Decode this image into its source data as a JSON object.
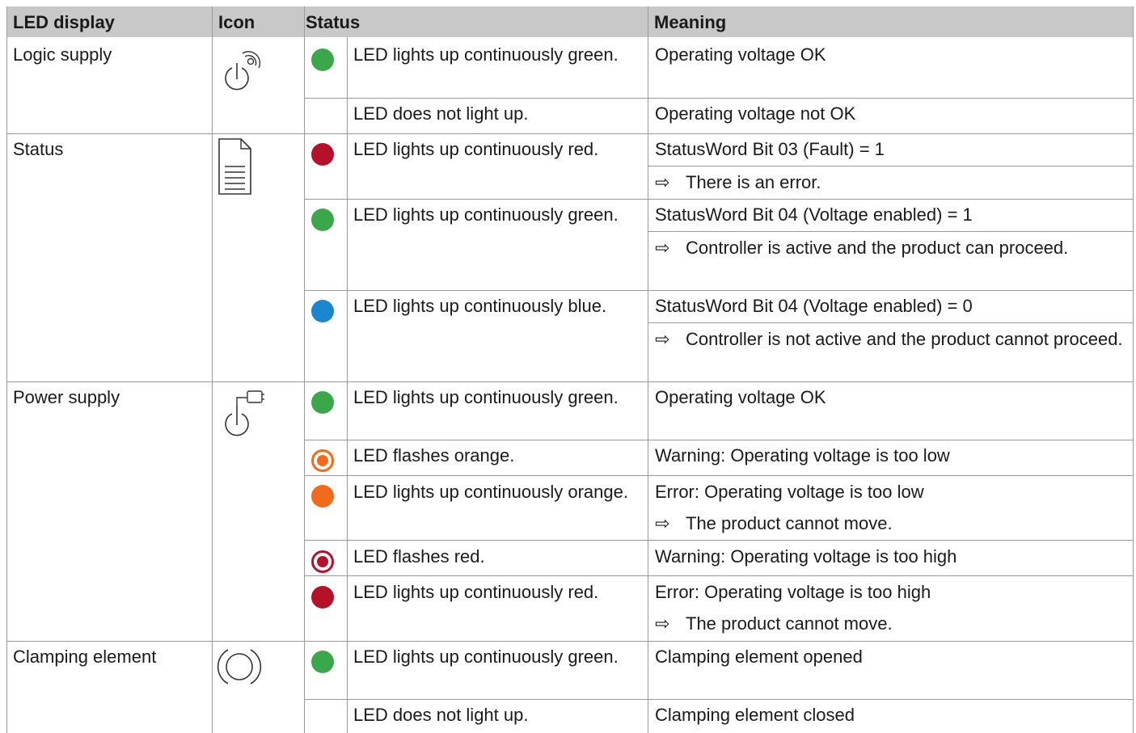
{
  "columns": [
    "LED display",
    "Icon",
    "Status",
    "Meaning"
  ],
  "colors": {
    "green": "#3aa84a",
    "red": "#b5122a",
    "blue": "#1a86d0",
    "orange": "#f26a1b",
    "header_bg": "#c8c8c8",
    "rule": "#9a9a9a"
  },
  "arrow_glyph": "⇨",
  "rows": [
    {
      "display": "Logic supply",
      "icon": "logic-supply-icon",
      "statuses": [
        {
          "led": "green",
          "text": "LED lights up continuously green.",
          "meanings": [
            "Operating voltage OK"
          ]
        },
        {
          "led": "none",
          "text": "LED does not light up.",
          "meanings": [
            "Operating voltage not OK"
          ]
        }
      ]
    },
    {
      "display": "Status",
      "icon": "document-icon",
      "statuses": [
        {
          "led": "red",
          "text": "LED lights up continuously red.",
          "meanings": [
            "StatusWord Bit 03 (Fault) = 1",
            "There is an error."
          ]
        },
        {
          "led": "green",
          "text": "LED lights up continuously green.",
          "meanings": [
            "StatusWord Bit 04 (Voltage enabled) = 1",
            "Controller is active and the product can proceed."
          ]
        },
        {
          "led": "blue",
          "text": "LED lights up continuously blue.",
          "meanings": [
            "StatusWord Bit 04 (Voltage enabled) = 0",
            "Controller is not active and the product cannot proceed."
          ]
        }
      ]
    },
    {
      "display": "Power supply",
      "icon": "power-supply-icon",
      "statuses": [
        {
          "led": "green",
          "text": "LED lights up continuously green.",
          "meanings": [
            "Operating voltage OK"
          ]
        },
        {
          "led": "orange-flash",
          "text": "LED flashes orange.",
          "meanings": [
            "Warning: Operating voltage is too low"
          ]
        },
        {
          "led": "orange",
          "text": "LED lights up continuously orange.",
          "meanings": [
            "Error: Operating voltage is too low",
            "The product cannot move."
          ]
        },
        {
          "led": "red-flash",
          "text": "LED flashes red.",
          "meanings": [
            "Warning: Operating voltage is too high"
          ]
        },
        {
          "led": "red",
          "text": "LED lights up continuously red.",
          "meanings": [
            "Error: Operating voltage is too high",
            "The product cannot move."
          ]
        }
      ]
    },
    {
      "display": "Clamping element",
      "icon": "clamping-element-icon",
      "statuses": [
        {
          "led": "green",
          "text": "LED lights up continuously green.",
          "meanings": [
            "Clamping element opened"
          ]
        },
        {
          "led": "none",
          "text": "LED does not light up.",
          "meanings": [
            "Clamping element closed"
          ]
        }
      ]
    }
  ]
}
